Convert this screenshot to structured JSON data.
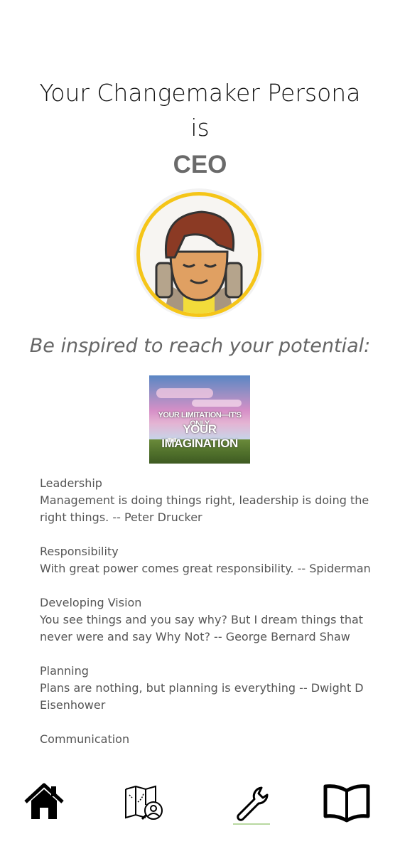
{
  "header": {
    "title_line1": "Your Changemaker Persona",
    "title_line2": "is",
    "persona_name": "CEO"
  },
  "avatar": {
    "icon": "persona-avatar-icon",
    "ring_color": "#f5c518"
  },
  "inspiration": {
    "heading": "Be inspired to reach your potential:",
    "image_text_line1": "YOUR LIMITATION—IT'S ONLY",
    "image_text_line2": "YOUR IMAGINATION"
  },
  "quotes": [
    {
      "topic": "Leadership",
      "text": "Management is doing things right, leadership is doing the right things. -- Peter Drucker"
    },
    {
      "topic": "Responsibility",
      "text": "With great power comes great responsibility. -- Spiderman"
    },
    {
      "topic": "Developing Vision",
      "text": "You see things and you say why? But I dream things that never were and say Why Not? -- George Bernard Shaw"
    },
    {
      "topic": "Planning",
      "text": "Plans are nothing, but planning is everything -- Dwight D Eisenhower"
    },
    {
      "topic": "Communication",
      "text": ""
    }
  ],
  "bottom_nav": [
    {
      "icon": "home-icon"
    },
    {
      "icon": "map-search-icon"
    },
    {
      "icon": "wrench-icon"
    },
    {
      "icon": "book-icon"
    }
  ]
}
